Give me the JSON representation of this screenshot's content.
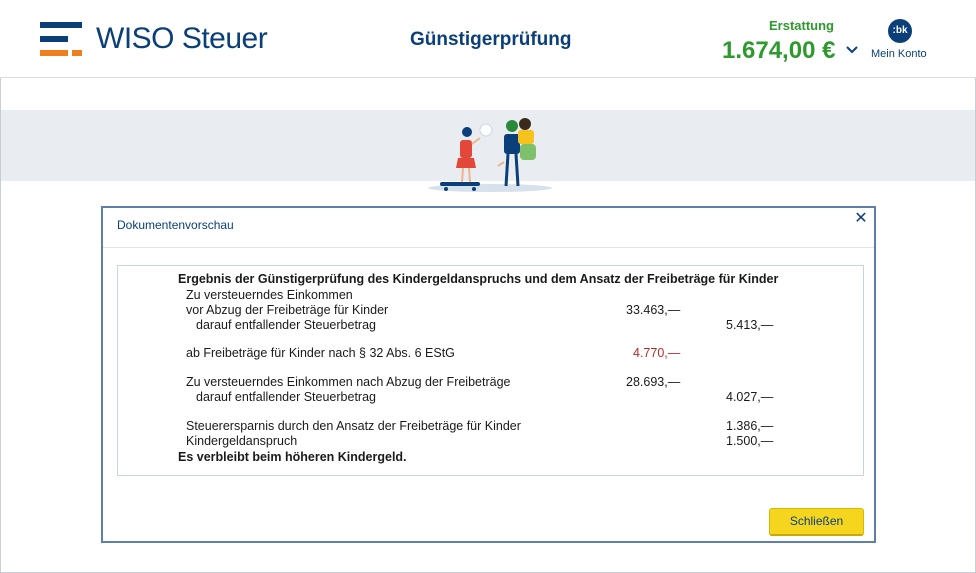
{
  "header": {
    "logo_text": "WISO Steuer",
    "page_title": "Günstigerprüfung",
    "refund_label": "Erstattung",
    "refund_amount": "1.674,00 €",
    "avatar_initials": ":bk",
    "account_label": "Mein Konto"
  },
  "modal": {
    "title": "Dokumentenvorschau",
    "close_label": "Schließen",
    "document": {
      "heading": "Ergebnis der Günstigerprüfung des Kindergeldanspruchs und dem Ansatz der Freibeträge für Kinder",
      "rows": {
        "r1": "Zu versteuerndes Einkommen",
        "r2": "vor Abzug der Freibeträge für Kinder",
        "r2_val": "33.463,—",
        "r3": "darauf entfallender Steuerbetrag",
        "r3_val": "5.413,—",
        "r4": "ab Freibeträge für Kinder nach § 32 Abs. 6 EStG",
        "r4_val": "4.770,—",
        "r5": "Zu versteuerndes Einkommen nach Abzug der Freibeträge",
        "r5_val": "28.693,—",
        "r6": "darauf entfallender Steuerbetrag",
        "r6_val": "4.027,—",
        "r7": "Steuerersparnis durch den Ansatz der Freibeträge für Kinder",
        "r7_val": "1.386,—",
        "r8": "Kindergeldanspruch",
        "r8_val": "1.500,—",
        "result": "Es verbleibt beim höheren Kindergeld."
      }
    }
  },
  "colors": {
    "brand_blue": "#0a3f7a",
    "brand_orange": "#f07d1e",
    "refund_green": "#2e9a2e",
    "negative_red": "#c0282a",
    "button_yellow": "#f6d51e"
  }
}
